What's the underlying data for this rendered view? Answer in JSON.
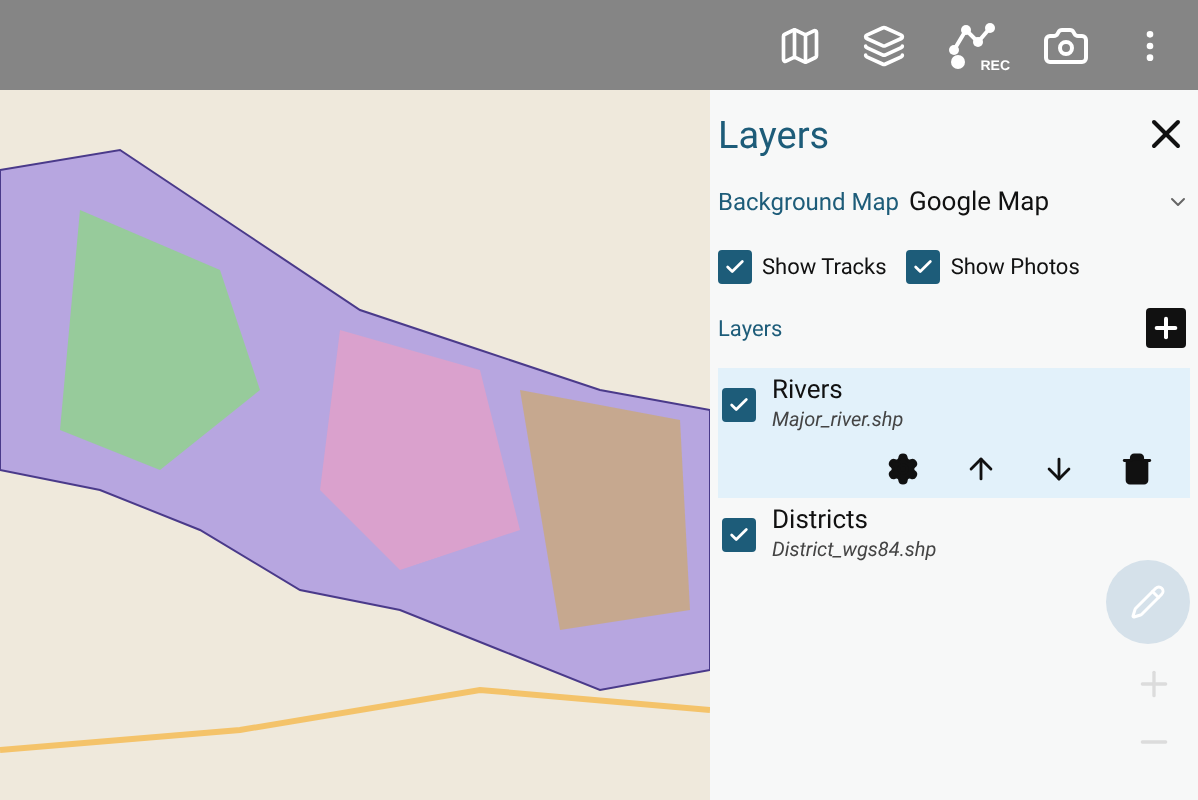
{
  "toolbar": {
    "rec_label": "REC"
  },
  "panel": {
    "title": "Layers",
    "background_map": {
      "label": "Background Map",
      "value": "Google Map"
    },
    "options": [
      {
        "label": "Show Tracks",
        "checked": true
      },
      {
        "label": "Show Photos",
        "checked": true
      }
    ],
    "layers_heading": "Layers",
    "layers": [
      {
        "name": "Rivers",
        "file": "Major_river.shp",
        "checked": true,
        "selected": true
      },
      {
        "name": "Districts",
        "file": "District_wgs84.shp",
        "checked": true,
        "selected": false
      }
    ]
  }
}
